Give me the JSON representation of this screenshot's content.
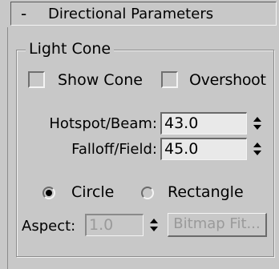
{
  "rollout": {
    "collapse_sign": "-",
    "title": "Directional Parameters"
  },
  "light_cone": {
    "group_label": "Light Cone",
    "show_cone": {
      "label": "Show Cone",
      "checked": false
    },
    "overshoot": {
      "label": "Overshoot",
      "checked": false
    },
    "hotspot": {
      "label": "Hotspot/Beam:",
      "value": "43.0"
    },
    "falloff": {
      "label": "Falloff/Field:",
      "value": "45.0"
    },
    "shape": {
      "circle_label": "Circle",
      "rectangle_label": "Rectangle",
      "selected": "Circle"
    },
    "aspect": {
      "label": "Aspect:",
      "value": "1.0",
      "enabled": false
    },
    "bitmap_fit_label": "Bitmap Fit..."
  }
}
